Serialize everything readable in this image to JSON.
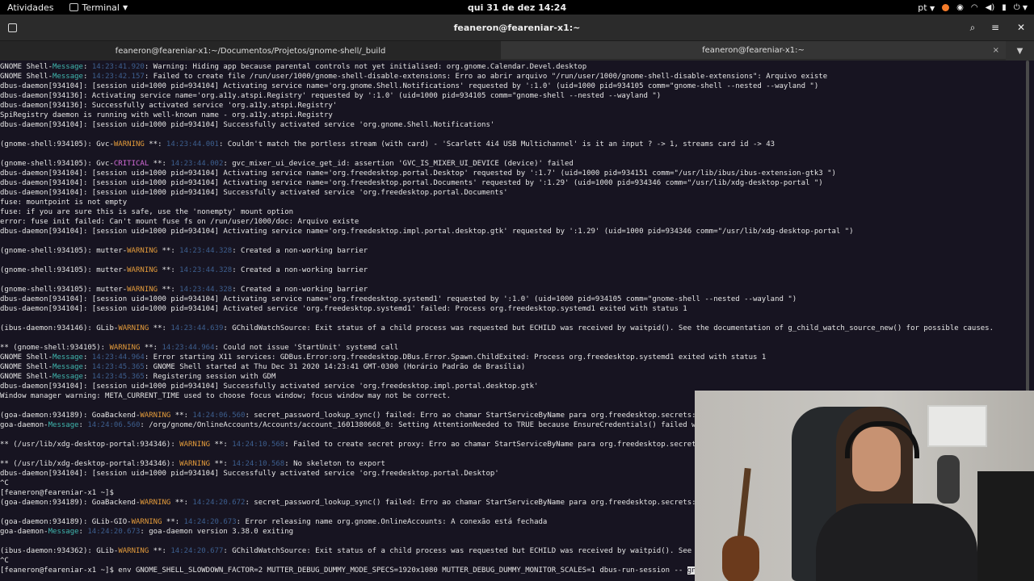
{
  "topbar": {
    "activities": "Atividades",
    "app_name": "Terminal",
    "clock": "qui 31 de dez  14:24",
    "language": "pt",
    "tray_icons": [
      "record-icon",
      "network-icon",
      "wifi-icon",
      "volume-icon",
      "battery-icon",
      "power-icon"
    ]
  },
  "window": {
    "title": "feaneron@feareniar-x1:~"
  },
  "tabs": [
    {
      "label": "feaneron@feareniar-x1:~/Documentos/Projetos/gnome-shell/_build"
    },
    {
      "label": "feaneron@feareniar-x1:~",
      "close": "×"
    }
  ],
  "terminal": {
    "lines": [
      [
        {
          "t": "GNOME Shell-"
        },
        {
          "t": "Message",
          "c": "msg"
        },
        {
          "t": ": "
        },
        {
          "t": "14:23:41.920",
          "c": "ts"
        },
        {
          "t": ": Warning: Hiding app because parental controls not yet initialised: org.gnome.Calendar.Devel.desktop"
        }
      ],
      [
        {
          "t": "GNOME Shell-"
        },
        {
          "t": "Message",
          "c": "msg"
        },
        {
          "t": ": "
        },
        {
          "t": "14:23:42.157",
          "c": "ts"
        },
        {
          "t": ": Failed to create file /run/user/1000/gnome-shell-disable-extensions: Erro ao abrir arquivo \"/run/user/1000/gnome-shell-disable-extensions\": Arquivo existe"
        }
      ],
      [
        {
          "t": "dbus-daemon[934104]: [session uid=1000 pid=934104] Activating service name='org.gnome.Shell.Notifications' requested by ':1.0' (uid=1000 pid=934105 comm=\"gnome-shell --nested --wayland \")"
        }
      ],
      [
        {
          "t": "dbus-daemon[934136]: Activating service name='org.a11y.atspi.Registry' requested by ':1.0' (uid=1000 pid=934105 comm=\"gnome-shell --nested --wayland \")"
        }
      ],
      [
        {
          "t": "dbus-daemon[934136]: Successfully activated service 'org.a11y.atspi.Registry'"
        }
      ],
      [
        {
          "t": "SpiRegistry daemon is running with well-known name - org.a11y.atspi.Registry"
        }
      ],
      [
        {
          "t": "dbus-daemon[934104]: [session uid=1000 pid=934104] Successfully activated service 'org.gnome.Shell.Notifications'"
        }
      ],
      [
        {
          "t": ""
        }
      ],
      [
        {
          "t": "(gnome-shell:934105): Gvc-"
        },
        {
          "t": "WARNING",
          "c": "warn"
        },
        {
          "t": " **: "
        },
        {
          "t": "14:23:44.001",
          "c": "ts"
        },
        {
          "t": ": Couldn't match the portless stream (with card) - 'Scarlett 4i4 USB Multichannel' is it an input ? -> 1, streams card id -> 43"
        }
      ],
      [
        {
          "t": ""
        }
      ],
      [
        {
          "t": "(gnome-shell:934105): Gvc-"
        },
        {
          "t": "CRITICAL",
          "c": "crit"
        },
        {
          "t": " **: "
        },
        {
          "t": "14:23:44.002",
          "c": "ts"
        },
        {
          "t": ": gvc_mixer_ui_device_get_id: assertion 'GVC_IS_MIXER_UI_DEVICE (device)' failed"
        }
      ],
      [
        {
          "t": "dbus-daemon[934104]: [session uid=1000 pid=934104] Activating service name='org.freedesktop.portal.Desktop' requested by ':1.7' (uid=1000 pid=934151 comm=\"/usr/lib/ibus/ibus-extension-gtk3 \")"
        }
      ],
      [
        {
          "t": "dbus-daemon[934104]: [session uid=1000 pid=934104] Activating service name='org.freedesktop.portal.Documents' requested by ':1.29' (uid=1000 pid=934346 comm=\"/usr/lib/xdg-desktop-portal \")"
        }
      ],
      [
        {
          "t": "dbus-daemon[934104]: [session uid=1000 pid=934104] Successfully activated service 'org.freedesktop.portal.Documents'"
        }
      ],
      [
        {
          "t": "fuse: mountpoint is not empty"
        }
      ],
      [
        {
          "t": "fuse: if you are sure this is safe, use the 'nonempty' mount option"
        }
      ],
      [
        {
          "t": "error: fuse init failed: Can't mount fuse fs on /run/user/1000/doc: Arquivo existe"
        }
      ],
      [
        {
          "t": "dbus-daemon[934104]: [session uid=1000 pid=934104] Activating service name='org.freedesktop.impl.portal.desktop.gtk' requested by ':1.29' (uid=1000 pid=934346 comm=\"/usr/lib/xdg-desktop-portal \")"
        }
      ],
      [
        {
          "t": ""
        }
      ],
      [
        {
          "t": "(gnome-shell:934105): mutter-"
        },
        {
          "t": "WARNING",
          "c": "warn"
        },
        {
          "t": " **: "
        },
        {
          "t": "14:23:44.328",
          "c": "ts"
        },
        {
          "t": ": Created a non-working barrier"
        }
      ],
      [
        {
          "t": ""
        }
      ],
      [
        {
          "t": "(gnome-shell:934105): mutter-"
        },
        {
          "t": "WARNING",
          "c": "warn"
        },
        {
          "t": " **: "
        },
        {
          "t": "14:23:44.328",
          "c": "ts"
        },
        {
          "t": ": Created a non-working barrier"
        }
      ],
      [
        {
          "t": ""
        }
      ],
      [
        {
          "t": "(gnome-shell:934105): mutter-"
        },
        {
          "t": "WARNING",
          "c": "warn"
        },
        {
          "t": " **: "
        },
        {
          "t": "14:23:44.328",
          "c": "ts"
        },
        {
          "t": ": Created a non-working barrier"
        }
      ],
      [
        {
          "t": "dbus-daemon[934104]: [session uid=1000 pid=934104] Activating service name='org.freedesktop.systemd1' requested by ':1.0' (uid=1000 pid=934105 comm=\"gnome-shell --nested --wayland \")"
        }
      ],
      [
        {
          "t": "dbus-daemon[934104]: [session uid=1000 pid=934104] Activated service 'org.freedesktop.systemd1' failed: Process org.freedesktop.systemd1 exited with status 1"
        }
      ],
      [
        {
          "t": ""
        }
      ],
      [
        {
          "t": "(ibus-daemon:934146): GLib-"
        },
        {
          "t": "WARNING",
          "c": "warn"
        },
        {
          "t": " **: "
        },
        {
          "t": "14:23:44.639",
          "c": "ts"
        },
        {
          "t": ": GChildWatchSource: Exit status of a child process was requested but ECHILD was received by waitpid(). See the documentation of g_child_watch_source_new() for possible causes."
        }
      ],
      [
        {
          "t": ""
        }
      ],
      [
        {
          "t": "** (gnome-shell:934105): "
        },
        {
          "t": "WARNING",
          "c": "warn"
        },
        {
          "t": " **: "
        },
        {
          "t": "14:23:44.964",
          "c": "ts"
        },
        {
          "t": ": Could not issue 'StartUnit' systemd call"
        }
      ],
      [
        {
          "t": "GNOME Shell-"
        },
        {
          "t": "Message",
          "c": "msg"
        },
        {
          "t": ": "
        },
        {
          "t": "14:23:44.964",
          "c": "ts"
        },
        {
          "t": ": Error starting X11 services: GDBus.Error:org.freedesktop.DBus.Error.Spawn.ChildExited: Process org.freedesktop.systemd1 exited with status 1"
        }
      ],
      [
        {
          "t": "GNOME Shell-"
        },
        {
          "t": "Message",
          "c": "msg"
        },
        {
          "t": ": "
        },
        {
          "t": "14:23:45.365",
          "c": "ts"
        },
        {
          "t": ": GNOME Shell started at Thu Dec 31 2020 14:23:41 GMT-0300 (Horário Padrão de Brasília)"
        }
      ],
      [
        {
          "t": "GNOME Shell-"
        },
        {
          "t": "Message",
          "c": "msg"
        },
        {
          "t": ": "
        },
        {
          "t": "14:23:45.365",
          "c": "ts"
        },
        {
          "t": ": Registering session with GDM"
        }
      ],
      [
        {
          "t": "dbus-daemon[934104]: [session uid=1000 pid=934104] Successfully activated service 'org.freedesktop.impl.portal.desktop.gtk'"
        }
      ],
      [
        {
          "t": "Window manager warning: META_CURRENT_TIME used to choose focus window; focus window may not be correct."
        }
      ],
      [
        {
          "t": ""
        }
      ],
      [
        {
          "t": "(goa-daemon:934189): GoaBackend-"
        },
        {
          "t": "WARNING",
          "c": "warn"
        },
        {
          "t": " **: "
        },
        {
          "t": "14:24:06.560",
          "c": "ts"
        },
        {
          "t": ": secret_password_lookup_sync() failed: Erro ao chamar StartServiceByName para org.freedesktop.secrets: O"
        }
      ],
      [
        {
          "t": "goa-daemon-"
        },
        {
          "t": "Message",
          "c": "msg"
        },
        {
          "t": ": "
        },
        {
          "t": "14:24:06.560",
          "c": "ts"
        },
        {
          "t": ": /org/gnome/OnlineAccounts/Accounts/account_1601380668_0: Setting AttentionNeeded to TRUE because EnsureCredentials() failed wit"
        }
      ],
      [
        {
          "t": ""
        }
      ],
      [
        {
          "t": "** (/usr/lib/xdg-desktop-portal:934346): "
        },
        {
          "t": "WARNING",
          "c": "warn"
        },
        {
          "t": " **: "
        },
        {
          "t": "14:24:10.568",
          "c": "ts"
        },
        {
          "t": ": Failed to create secret proxy: Erro ao chamar StartServiceByName para org.freedesktop.secrets:"
        }
      ],
      [
        {
          "t": ""
        }
      ],
      [
        {
          "t": "** (/usr/lib/xdg-desktop-portal:934346): "
        },
        {
          "t": "WARNING",
          "c": "warn"
        },
        {
          "t": " **: "
        },
        {
          "t": "14:24:10.568",
          "c": "ts"
        },
        {
          "t": ": No skeleton to export"
        }
      ],
      [
        {
          "t": "dbus-daemon[934104]: [session uid=1000 pid=934104] Successfully activated service 'org.freedesktop.portal.Desktop'"
        }
      ],
      [
        {
          "t": "^C"
        }
      ],
      [
        {
          "t": "[feaneron@feareniar-x1 ~]$"
        }
      ],
      [
        {
          "t": "(goa-daemon:934189): GoaBackend-"
        },
        {
          "t": "WARNING",
          "c": "warn"
        },
        {
          "t": " **: "
        },
        {
          "t": "14:24:20.672",
          "c": "ts"
        },
        {
          "t": ": secret_password_lookup_sync() failed: Erro ao chamar StartServiceByName para org.freedesktop.secrets: A"
        }
      ],
      [
        {
          "t": ""
        }
      ],
      [
        {
          "t": "(goa-daemon:934189): GLib-GIO-"
        },
        {
          "t": "WARNING",
          "c": "warn"
        },
        {
          "t": " **: "
        },
        {
          "t": "14:24:20.673",
          "c": "ts"
        },
        {
          "t": ": Error releasing name org.gnome.OnlineAccounts: A conexão está fechada"
        }
      ],
      [
        {
          "t": "goa-daemon-"
        },
        {
          "t": "Message",
          "c": "msg"
        },
        {
          "t": ": "
        },
        {
          "t": "14:24:20.673",
          "c": "ts"
        },
        {
          "t": ": goa-daemon version 3.38.0 exiting"
        }
      ],
      [
        {
          "t": ""
        }
      ],
      [
        {
          "t": "(ibus-daemon:934362): GLib-"
        },
        {
          "t": "WARNING",
          "c": "warn"
        },
        {
          "t": " **: "
        },
        {
          "t": "14:24:20.677",
          "c": "ts"
        },
        {
          "t": ": GChildWatchSource: Exit status of a child process was requested but ECHILD was received by waitpid(). See th"
        }
      ],
      [
        {
          "t": "^C"
        }
      ],
      [
        {
          "t": "[feaneron@feareniar-x1 ~]$ env GNOME_SHELL_SLOWDOWN_FACTOR=2 MUTTER_DEBUG_DUMMY_MODE_SPECS=1920x1080 MUTTER_DEBUG_DUMMY_MONITOR_SCALES=1 dbus-run-session -- "
        },
        {
          "t": "gnom",
          "c": "cursor"
        }
      ]
    ]
  }
}
